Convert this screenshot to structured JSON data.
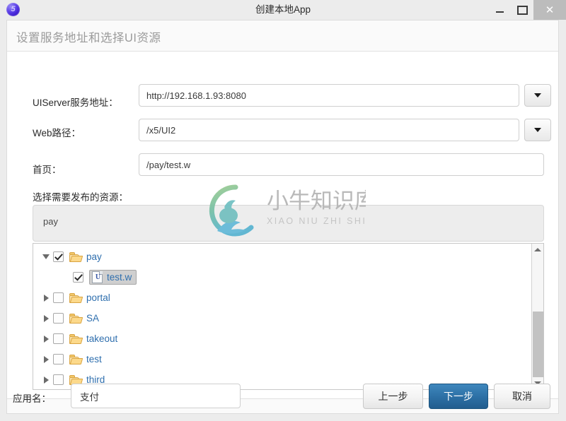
{
  "window": {
    "title": "创建本地App",
    "icon_name": "app-logo-icon",
    "icon_glyph": "5",
    "controls": {
      "minimize_label": "minimize-icon",
      "maximize_label": "maximize-icon",
      "close_label": "✕"
    }
  },
  "header": {
    "title": "设置服务地址和选择UI资源"
  },
  "form": {
    "uiserver": {
      "label": "UIServer服务地址：",
      "value": "http://192.168.1.93:8080",
      "placeholder": "",
      "has_dropdown": true
    },
    "webpath": {
      "label": "Web路径：",
      "value": "/x5/UI2",
      "placeholder": "",
      "has_dropdown": true
    },
    "homepage": {
      "label": "首页：",
      "value": "/pay/test.w",
      "placeholder": "",
      "has_dropdown": false
    }
  },
  "resources": {
    "label": "选择需要发布的资源：",
    "selected_summary": "pay",
    "tree": [
      {
        "label": "pay",
        "level": 1,
        "expanded": true,
        "checked": true,
        "type": "folder",
        "selected": false,
        "has_children": true
      },
      {
        "label": "test.w",
        "level": 2,
        "expanded": null,
        "checked": true,
        "type": "file",
        "selected": true,
        "has_children": false,
        "file_glyph": "U"
      },
      {
        "label": "portal",
        "level": 1,
        "expanded": false,
        "checked": false,
        "type": "folder",
        "selected": false,
        "has_children": true
      },
      {
        "label": "SA",
        "level": 1,
        "expanded": false,
        "checked": false,
        "type": "folder",
        "selected": false,
        "has_children": true
      },
      {
        "label": "takeout",
        "level": 1,
        "expanded": false,
        "checked": false,
        "type": "folder",
        "selected": false,
        "has_children": true
      },
      {
        "label": "test",
        "level": 1,
        "expanded": false,
        "checked": false,
        "type": "folder",
        "selected": false,
        "has_children": true
      },
      {
        "label": "third",
        "level": 1,
        "expanded": false,
        "checked": false,
        "type": "folder",
        "selected": false,
        "has_children": true
      }
    ]
  },
  "footer": {
    "appname": {
      "label": "应用名：",
      "value": "支付",
      "placeholder": ""
    },
    "buttons": {
      "prev": "上一步",
      "next": "下一步",
      "cancel": "取消"
    }
  },
  "watermark": {
    "title": "小牛知识库",
    "subtitle": "XIAO NIU ZHI SHI KU"
  },
  "colors": {
    "primary_button": "#2c6fa4",
    "link_text": "#2f6fae",
    "header_text": "#9b9b9b",
    "folder": "#fcd98b",
    "close_button_bg": "#bcbcbc",
    "watermark_green": "#8bc48a",
    "watermark_blue": "#5fb3c9"
  }
}
